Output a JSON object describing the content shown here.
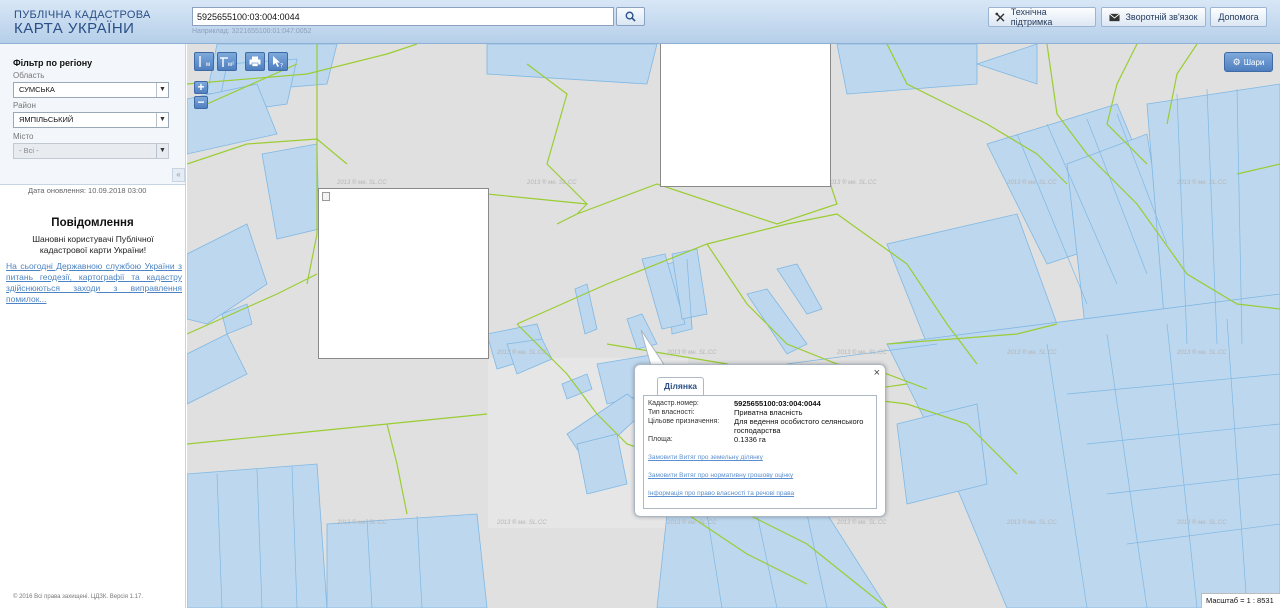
{
  "header": {
    "logo_top": "ПУБЛІЧНА КАДАСТРОВА",
    "logo_main": "КАРТА УКРАЇНИ",
    "search_value": "5925655100:03:004:0044",
    "search_example": "Наприклад: 3221655100:01:047:0052",
    "support_label": "Технічна підтримка",
    "feedback_label": "Зворотній зв'язок",
    "help_label": "Допомога"
  },
  "sidebar": {
    "filter_title": "Фільтр по регіону",
    "region_label": "Область",
    "region_value": "СУМСЬКА",
    "district_label": "Район",
    "district_value": "ЯМПІЛЬСЬКИЙ",
    "city_label": "Місто",
    "city_value": "- Всі -",
    "update_date": "Дата оновлення: 10.09.2018 03:00",
    "notice_title": "Повідомлення",
    "notice_text": "Шановні користувачі Публічної кадастрової карти України!",
    "notice_link": "На сьогодні Державною службою України з питань геодезії, картографії та кадастру здійснюються заходи з виправлення помилок...",
    "copyright": "© 2016 Всі права захищені. ЦДЗК. Версія 1.17."
  },
  "map": {
    "layers_label": "Шари",
    "scale_text": "Масштаб = 1 : 8531",
    "watermark": "2013 ® ме. SL.CC",
    "toolbar": {
      "measure_line": "м",
      "measure_area": "м²"
    },
    "colors": {
      "parcel_fill": "#bdd7ee",
      "parcel_stroke": "#7fb8e4",
      "boundary": "#9acd32",
      "background": "#e0e0e0"
    }
  },
  "popup": {
    "tab_label": "Ділянка",
    "rows": [
      {
        "label": "Кадастр.номер:",
        "value": "5925655100:03:004:0044"
      },
      {
        "label": "Тип власності:",
        "value": "Приватна власність"
      },
      {
        "label": "Цільове призначення:",
        "value": "Для ведення особистого селянського господарства"
      },
      {
        "label": "Площа:",
        "value": "0.1336 га"
      }
    ],
    "links": [
      "Замовити Витяг про земельну ділянку",
      "Замовити Витяг про нормативну грошову оцінку",
      "Інформація про право власності та речові права"
    ]
  }
}
